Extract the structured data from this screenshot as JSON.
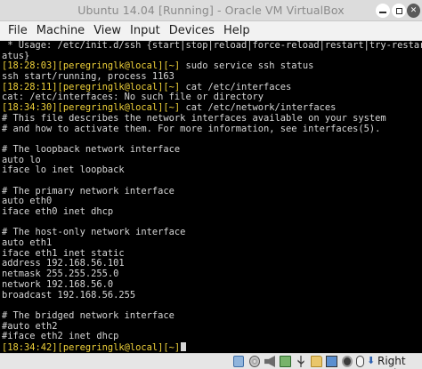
{
  "window": {
    "title": "Ubuntu 14.04 [Running] - Oracle VM VirtualBox",
    "close_glyph": "✕"
  },
  "menu": [
    "File",
    "Machine",
    "View",
    "Input",
    "Devices",
    "Help"
  ],
  "terminal": {
    "colors": {
      "background": "#000000",
      "text": "#d7d7d7",
      "prompt": "#f0d23a"
    },
    "lines": [
      {
        "text": " * Usage: /etc/init.d/ssh {start|stop|reload|force-reload|restart|try-restart|st"
      },
      {
        "text": "atus}"
      },
      {
        "prompt": "[18:28:03][peregringlk@local][~]",
        "text": " sudo service ssh status"
      },
      {
        "text": "ssh start/running, process 1163"
      },
      {
        "prompt": "[18:28:11][peregringlk@local][~]",
        "text": " cat /etc/interfaces"
      },
      {
        "text": "cat: /etc/interfaces: No such file or directory"
      },
      {
        "prompt": "[18:34:30][peregringlk@local][~]",
        "text": " cat /etc/network/interfaces"
      },
      {
        "text": "# This file describes the network interfaces available on your system"
      },
      {
        "text": "# and how to activate them. For more information, see interfaces(5)."
      },
      {
        "text": ""
      },
      {
        "text": "# The loopback network interface"
      },
      {
        "text": "auto lo"
      },
      {
        "text": "iface lo inet loopback"
      },
      {
        "text": ""
      },
      {
        "text": "# The primary network interface"
      },
      {
        "text": "auto eth0"
      },
      {
        "text": "iface eth0 inet dhcp"
      },
      {
        "text": ""
      },
      {
        "text": "# The host-only network interface"
      },
      {
        "text": "auto eth1"
      },
      {
        "text": "iface eth1 inet static"
      },
      {
        "text": "address 192.168.56.101"
      },
      {
        "text": "netmask 255.255.255.0"
      },
      {
        "text": "network 192.168.56.0"
      },
      {
        "text": "broadcast 192.168.56.255"
      },
      {
        "text": ""
      },
      {
        "text": "# The bridged network interface"
      },
      {
        "text": "#auto eth2"
      },
      {
        "text": "#iface eth2 inet dhcp"
      },
      {
        "prompt": "[18:34:42][peregringlk@local][~]",
        "text": "",
        "cursor": true
      }
    ]
  },
  "statusbar": {
    "icons": [
      "hard-disk-icon",
      "optical-drive-icon",
      "audio-icon",
      "network-icon",
      "usb-icon",
      "shared-folder-icon",
      "display-icon",
      "video-capture-icon",
      "mouse-integration-icon"
    ],
    "host_key_arrow": "⬇",
    "host_key_label": "Right Ctrl"
  }
}
